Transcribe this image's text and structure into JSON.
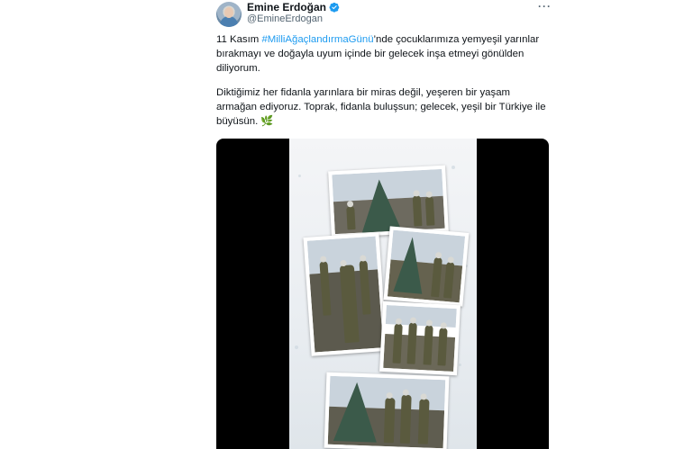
{
  "author": {
    "display_name": "Emine Erdoğan",
    "handle": "@EmineErdogan",
    "verified": true,
    "verified_color": "#1d9bf0"
  },
  "menu": {
    "more_label": "···"
  },
  "tweet": {
    "p1_prefix": "11 Kasım ",
    "hashtag": "#MilliAğaçlandırmaGünü",
    "p1_suffix": "’nde çocuklarımıza yemyeşil yarınlar bırakmayı ve doğayla uyum içinde bir gelecek inşa etmeyi gönülden diliyorum.",
    "p2": "Diktiğimiz her fidanla yarınlara bir miras değil, yeşeren bir yaşam armağan ediyoruz. Toprak, fidanla buluşsun; gelecek, yeşil bir Türkiye ile büyüsün.",
    "emoji": "🌿",
    "hashtag_color": "#1d9bf0"
  },
  "media": {
    "type": "video-collage",
    "subject_icon": "tree-planting-photos"
  }
}
